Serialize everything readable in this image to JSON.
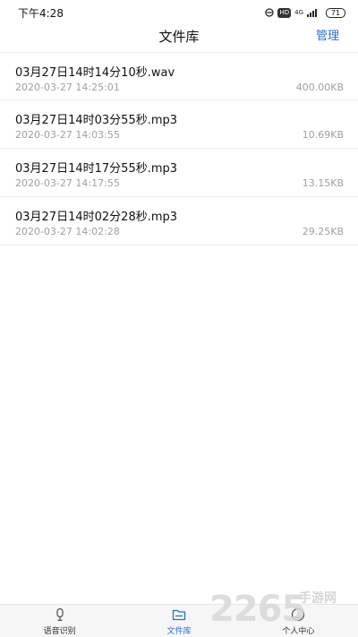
{
  "status_bar": {
    "time": "下午4:28",
    "hd_badge": "HD",
    "network": "4G",
    "battery": "71"
  },
  "header": {
    "title": "文件库",
    "action_label": "管理"
  },
  "files": [
    {
      "name": "03月27日14时14分10秒.wav",
      "date": "2020-03-27 14:25:01",
      "size": "400.00KB"
    },
    {
      "name": "03月27日14时03分55秒.mp3",
      "date": "2020-03-27 14:03:55",
      "size": "10.69KB"
    },
    {
      "name": "03月27日14时17分55秒.mp3",
      "date": "2020-03-27 14:17:55",
      "size": "13.15KB"
    },
    {
      "name": "03月27日14时02分28秒.mp3",
      "date": "2020-03-27 14:02:28",
      "size": "29.25KB"
    }
  ],
  "tabs": [
    {
      "label": "语音识别",
      "icon": "microphone-icon",
      "active": false
    },
    {
      "label": "文件库",
      "icon": "folder-icon",
      "active": true
    },
    {
      "label": "个人中心",
      "icon": "person-icon",
      "active": false
    }
  ],
  "watermark": {
    "text": "2265",
    "cn": "手游网"
  },
  "colors": {
    "accent": "#2b6fc9",
    "secondary_text": "#a0a0a0",
    "tab_bar_bg": "#f6f6f6"
  }
}
